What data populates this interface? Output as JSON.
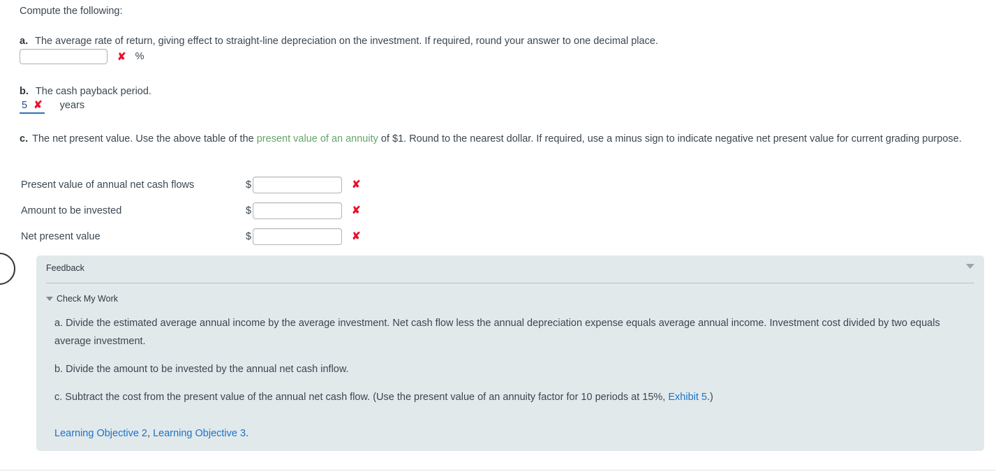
{
  "question": {
    "intro": "Compute the following:",
    "part_a": {
      "letter": "a.",
      "text": "The average rate of return, giving effect to straight-line depreciation on the investment. If required, round your answer to one decimal place.",
      "input_value": "",
      "input_placeholder": "",
      "mark": "✘",
      "unit": "%"
    },
    "part_b": {
      "letter": "b.",
      "text": "The cash payback period.",
      "answer_value": "5",
      "mark": "✘",
      "unit": "years"
    },
    "part_c": {
      "letter": "c.",
      "text_before_link": "The net present value. Use the above table of the ",
      "link_text": "present value of an annuity",
      "text_after_link": " of $1. Round to the nearest dollar. If required, use a minus sign to indicate negative net present value for current grading purpose.",
      "rows": [
        {
          "label": "Present value of annual net cash flows",
          "currency": "$",
          "value": "",
          "mark": "✘"
        },
        {
          "label": "Amount to be invested",
          "currency": "$",
          "value": "",
          "mark": "✘"
        },
        {
          "label": "Net present value",
          "currency": "$",
          "value": "",
          "mark": "✘"
        }
      ]
    }
  },
  "feedback": {
    "title": "Feedback",
    "collapse_icon": "chevron-down-icon",
    "check_my_work_label": "Check My Work",
    "paragraphs": [
      "a. Divide the estimated average annual income by the average investment. Net cash flow less the annual depreciation expense equals average annual income. Investment cost divided by two equals average investment.",
      "b. Divide the amount to be invested by the annual net cash inflow."
    ],
    "paragraph_c": {
      "before_link": "c. Subtract the cost from the present value of the annual net cash flow. (Use the present value of an annuity factor for 10 periods at 15%, ",
      "link_text": "Exhibit 5",
      "after_link": ".)"
    },
    "objectives": {
      "link1": "Learning Objective 2",
      "separator": ", ",
      "link2": "Learning Objective 3",
      "period": "."
    }
  },
  "colors": {
    "error_red": "#e8112d",
    "link_green": "#63a46c",
    "link_blue": "#1a73c8",
    "feedback_bg": "#e2e9eb",
    "graded_underline": "#2a72b5"
  }
}
